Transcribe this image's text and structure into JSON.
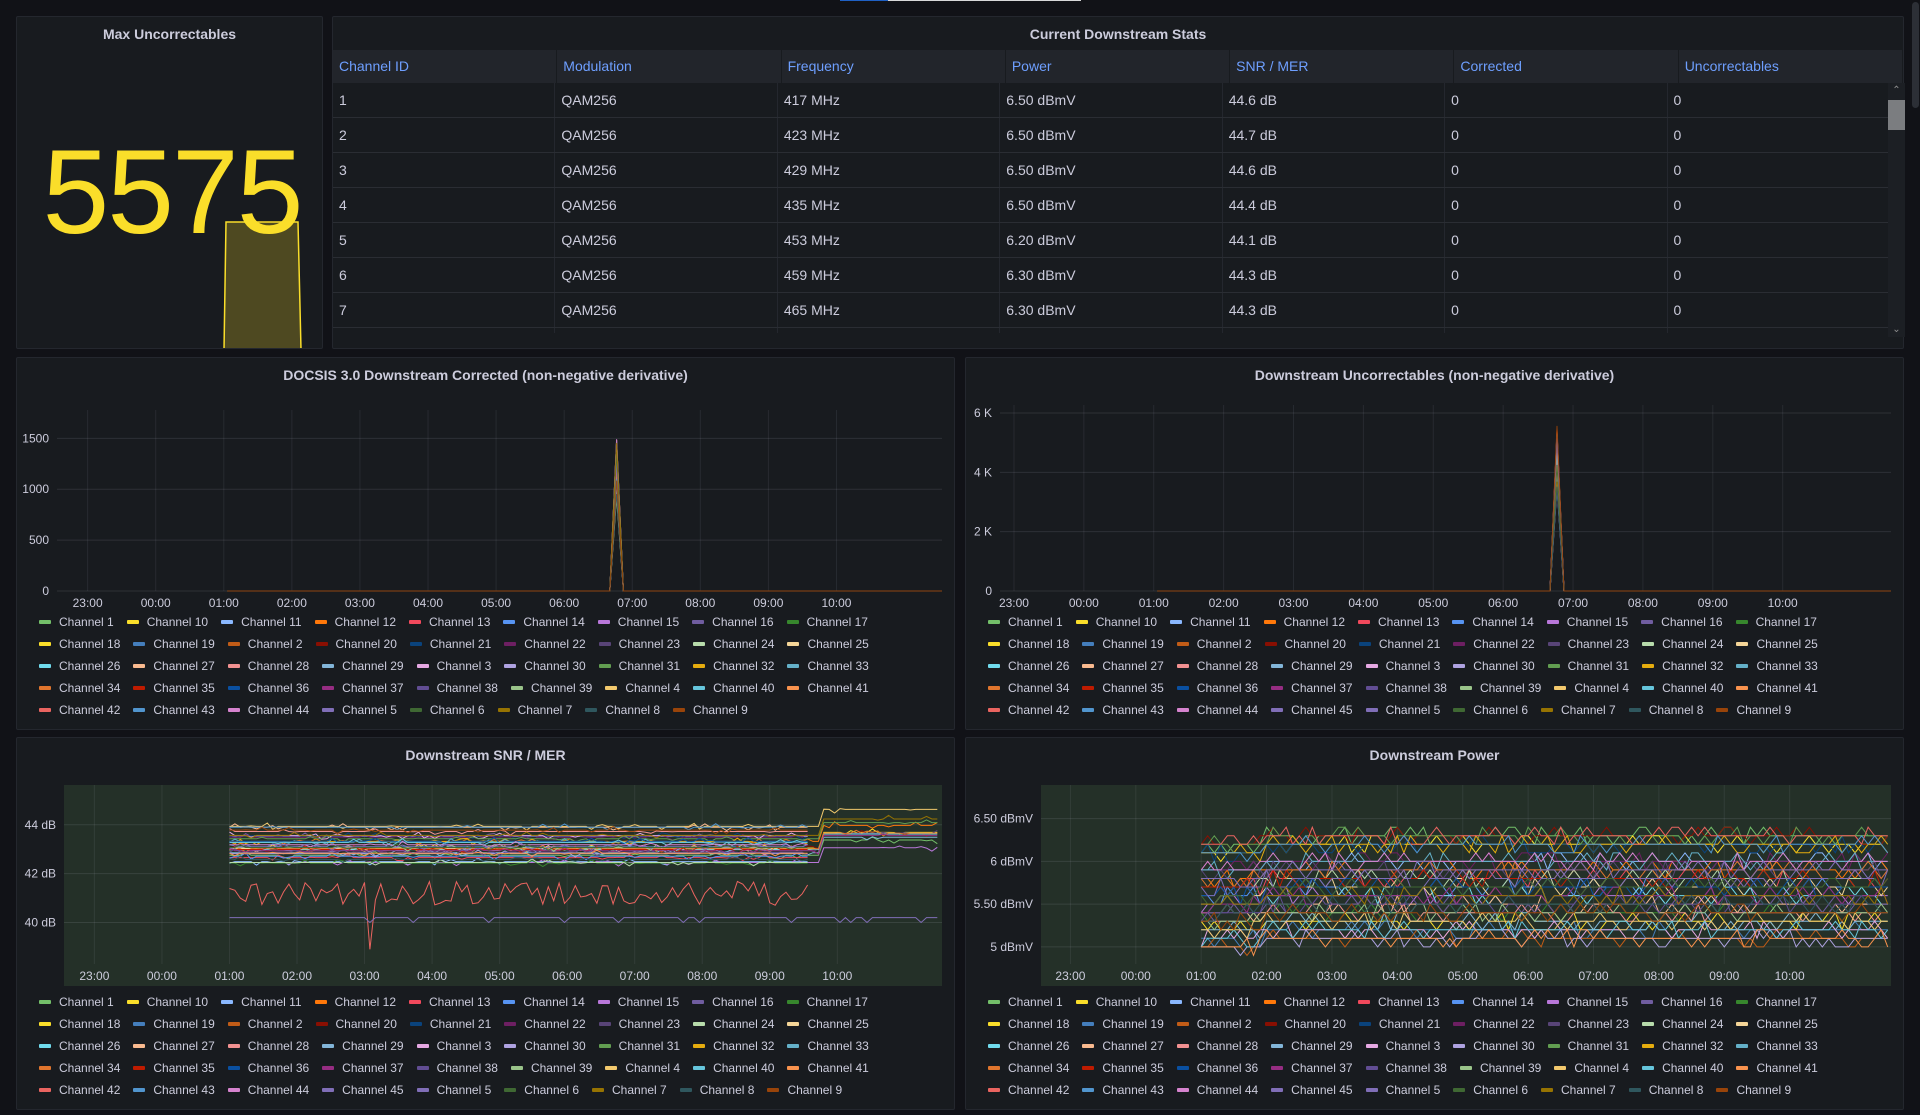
{
  "topbar": {
    "active_tab_color": "#1f60c4"
  },
  "stat": {
    "title": "Max Uncorrectables",
    "value": "5575",
    "color": "#fade2a"
  },
  "table": {
    "title": "Current Downstream Stats",
    "columns": [
      "Channel ID",
      "Modulation",
      "Frequency",
      "Power",
      "SNR / MER",
      "Corrected",
      "Uncorrectables"
    ],
    "rows": [
      [
        "1",
        "QAM256",
        "417 MHz",
        "6.50 dBmV",
        "44.6 dB",
        "0",
        "0"
      ],
      [
        "2",
        "QAM256",
        "423 MHz",
        "6.50 dBmV",
        "44.7 dB",
        "0",
        "0"
      ],
      [
        "3",
        "QAM256",
        "429 MHz",
        "6.50 dBmV",
        "44.6 dB",
        "0",
        "0"
      ],
      [
        "4",
        "QAM256",
        "435 MHz",
        "6.50 dBmV",
        "44.4 dB",
        "0",
        "0"
      ],
      [
        "5",
        "QAM256",
        "453 MHz",
        "6.20 dBmV",
        "44.1 dB",
        "0",
        "0"
      ],
      [
        "6",
        "QAM256",
        "459 MHz",
        "6.30 dBmV",
        "44.3 dB",
        "0",
        "0"
      ],
      [
        "7",
        "QAM256",
        "465 MHz",
        "6.30 dBmV",
        "44.3 dB",
        "0",
        "0"
      ]
    ],
    "scroll_up_icon": "⌃",
    "scroll_down_icon": "⌄"
  },
  "legend_colors": {
    "Channel 1": "#73bf69",
    "Channel 10": "#fade2a",
    "Channel 11": "#8ab8ff",
    "Channel 12": "#ff780a",
    "Channel 13": "#f2495c",
    "Channel 14": "#5794f2",
    "Channel 15": "#b877d9",
    "Channel 16": "#705da0",
    "Channel 17": "#37872d",
    "Channel 18": "#fade2a",
    "Channel 19": "#447ebc",
    "Channel 2": "#c15c17",
    "Channel 20": "#890f02",
    "Channel 21": "#0a437c",
    "Channel 22": "#6d1f62",
    "Channel 23": "#584477",
    "Channel 24": "#b7dbab",
    "Channel 25": "#f4d598",
    "Channel 26": "#70dbed",
    "Channel 27": "#f9ba8f",
    "Channel 28": "#f29191",
    "Channel 29": "#82b5d8",
    "Channel 3": "#e5a8e2",
    "Channel 30": "#aea2e0",
    "Channel 31": "#629e51",
    "Channel 32": "#e5ac0e",
    "Channel 33": "#64b0c8",
    "Channel 34": "#e0752d",
    "Channel 35": "#bf1b00",
    "Channel 36": "#0a50a1",
    "Channel 37": "#962d82",
    "Channel 38": "#614d93",
    "Channel 39": "#9ac48a",
    "Channel 4": "#f2c96d",
    "Channel 40": "#65c5db",
    "Channel 41": "#f9934e",
    "Channel 42": "#ea6460",
    "Channel 43": "#5195ce",
    "Channel 44": "#d683ce",
    "Channel 45": "#806eb7",
    "Channel 5": "#806eb7",
    "Channel 6": "#3f6833",
    "Channel 7": "#967302",
    "Channel 8": "#2f575e",
    "Channel 9": "#99440a"
  },
  "chart_data": [
    {
      "id": "corr",
      "type": "line",
      "title": "DOCSIS 3.0 Downstream Corrected (non-negative derivative)",
      "x_ticks": [
        "23:00",
        "00:00",
        "01:00",
        "02:00",
        "03:00",
        "04:00",
        "05:00",
        "06:00",
        "07:00",
        "08:00",
        "09:00",
        "10:00"
      ],
      "y_ticks": [
        "0",
        "500",
        "1000",
        "1500"
      ],
      "ylim": [
        0,
        1700
      ],
      "xlim_hours": [
        -1.45,
        11.55
      ],
      "grid": true,
      "legend_placement": "bottom",
      "series_summary": {
        "data_start_hour": 1.05,
        "data_end_hour": 11.55,
        "baseline": 0,
        "spike_hour": 6.77,
        "spike_peak": 1530,
        "spike_width_hours": 0.2
      },
      "legend": [
        "Channel 1",
        "Channel 10",
        "Channel 11",
        "Channel 12",
        "Channel 13",
        "Channel 14",
        "Channel 15",
        "Channel 16",
        "Channel 17",
        "Channel 18",
        "Channel 19",
        "Channel 2",
        "Channel 20",
        "Channel 21",
        "Channel 22",
        "Channel 23",
        "Channel 24",
        "Channel 25",
        "Channel 26",
        "Channel 27",
        "Channel 28",
        "Channel 29",
        "Channel 3",
        "Channel 30",
        "Channel 31",
        "Channel 32",
        "Channel 33",
        "Channel 34",
        "Channel 35",
        "Channel 36",
        "Channel 37",
        "Channel 38",
        "Channel 39",
        "Channel 4",
        "Channel 40",
        "Channel 41",
        "Channel 42",
        "Channel 43",
        "Channel 44",
        "Channel 5",
        "Channel 6",
        "Channel 7",
        "Channel 8",
        "Channel 9"
      ]
    },
    {
      "id": "unc",
      "type": "line",
      "title": "Downstream Uncorrectables (non-negative derivative)",
      "x_ticks": [
        "23:00",
        "00:00",
        "01:00",
        "02:00",
        "03:00",
        "04:00",
        "05:00",
        "06:00",
        "07:00",
        "08:00",
        "09:00",
        "10:00"
      ],
      "y_ticks": [
        "0",
        "2 K",
        "4 K",
        "6 K"
      ],
      "ylim": [
        0,
        6000
      ],
      "xlim_hours": [
        -1.2,
        11.55
      ],
      "grid": true,
      "legend_placement": "bottom",
      "series_summary": {
        "data_start_hour": 1.05,
        "data_end_hour": 11.55,
        "baseline": 0,
        "spike_hour": 6.77,
        "spike_peak": 5575,
        "spike_width_hours": 0.2
      },
      "legend": [
        "Channel 1",
        "Channel 10",
        "Channel 11",
        "Channel 12",
        "Channel 13",
        "Channel 14",
        "Channel 15",
        "Channel 16",
        "Channel 17",
        "Channel 18",
        "Channel 19",
        "Channel 2",
        "Channel 20",
        "Channel 21",
        "Channel 22",
        "Channel 23",
        "Channel 24",
        "Channel 25",
        "Channel 26",
        "Channel 27",
        "Channel 28",
        "Channel 29",
        "Channel 3",
        "Channel 30",
        "Channel 31",
        "Channel 32",
        "Channel 33",
        "Channel 34",
        "Channel 35",
        "Channel 36",
        "Channel 37",
        "Channel 38",
        "Channel 39",
        "Channel 4",
        "Channel 40",
        "Channel 41",
        "Channel 42",
        "Channel 43",
        "Channel 44",
        "Channel 45",
        "Channel 5",
        "Channel 6",
        "Channel 7",
        "Channel 8",
        "Channel 9"
      ]
    },
    {
      "id": "snr",
      "type": "line",
      "title": "Downstream SNR / MER",
      "x_ticks": [
        "23:00",
        "00:00",
        "01:00",
        "02:00",
        "03:00",
        "04:00",
        "05:00",
        "06:00",
        "07:00",
        "08:00",
        "09:00",
        "10:00"
      ],
      "y_ticks": [
        "40 dB",
        "42 dB",
        "44 dB"
      ],
      "ylim": [
        38.3,
        45.3
      ],
      "xlim_hours": [
        -1.45,
        11.55
      ],
      "grid": true,
      "legend_placement": "bottom",
      "series_summary": {
        "data_start_hour": 1.0,
        "data_end_hour": 11.55,
        "band_low_db": 42.4,
        "band_high_db": 44.0,
        "late_band_low_db": 43.0,
        "late_band_high_db": 44.7,
        "noisy_series": "Channel 42",
        "noisy_range_db": [
          38.9,
          42.3
        ],
        "low_series": "Channel 45",
        "low_db": 40.2
      },
      "legend": [
        "Channel 1",
        "Channel 10",
        "Channel 11",
        "Channel 12",
        "Channel 13",
        "Channel 14",
        "Channel 15",
        "Channel 16",
        "Channel 17",
        "Channel 18",
        "Channel 19",
        "Channel 2",
        "Channel 20",
        "Channel 21",
        "Channel 22",
        "Channel 23",
        "Channel 24",
        "Channel 25",
        "Channel 26",
        "Channel 27",
        "Channel 28",
        "Channel 29",
        "Channel 3",
        "Channel 30",
        "Channel 31",
        "Channel 32",
        "Channel 33",
        "Channel 34",
        "Channel 35",
        "Channel 36",
        "Channel 37",
        "Channel 38",
        "Channel 39",
        "Channel 4",
        "Channel 40",
        "Channel 41",
        "Channel 42",
        "Channel 43",
        "Channel 44",
        "Channel 45",
        "Channel 5",
        "Channel 6",
        "Channel 7",
        "Channel 8",
        "Channel 9"
      ]
    },
    {
      "id": "pow",
      "type": "line",
      "title": "Downstream Power",
      "x_ticks": [
        "23:00",
        "00:00",
        "01:00",
        "02:00",
        "03:00",
        "04:00",
        "05:00",
        "06:00",
        "07:00",
        "08:00",
        "09:00",
        "10:00"
      ],
      "y_ticks": [
        "5 dBmV",
        "5.50 dBmV",
        "6 dBmV",
        "6.50 dBmV"
      ],
      "ylim": [
        4.8,
        6.8
      ],
      "xlim_hours": [
        -1.45,
        11.55
      ],
      "grid": true,
      "legend_placement": "bottom",
      "series_summary": {
        "data_start_hour": 1.0,
        "data_end_hour": 11.55,
        "levels_dbmv": [
          6.3,
          6.2,
          6.0,
          5.9,
          5.8,
          5.7,
          5.6,
          5.5,
          5.4,
          5.3,
          5.2,
          5.1
        ]
      },
      "legend": [
        "Channel 1",
        "Channel 10",
        "Channel 11",
        "Channel 12",
        "Channel 13",
        "Channel 14",
        "Channel 15",
        "Channel 16",
        "Channel 17",
        "Channel 18",
        "Channel 19",
        "Channel 2",
        "Channel 20",
        "Channel 21",
        "Channel 22",
        "Channel 23",
        "Channel 24",
        "Channel 25",
        "Channel 26",
        "Channel 27",
        "Channel 28",
        "Channel 29",
        "Channel 3",
        "Channel 30",
        "Channel 31",
        "Channel 32",
        "Channel 33",
        "Channel 34",
        "Channel 35",
        "Channel 36",
        "Channel 37",
        "Channel 38",
        "Channel 39",
        "Channel 4",
        "Channel 40",
        "Channel 41",
        "Channel 42",
        "Channel 43",
        "Channel 44",
        "Channel 45",
        "Channel 5",
        "Channel 6",
        "Channel 7",
        "Channel 8",
        "Channel 9"
      ]
    }
  ]
}
